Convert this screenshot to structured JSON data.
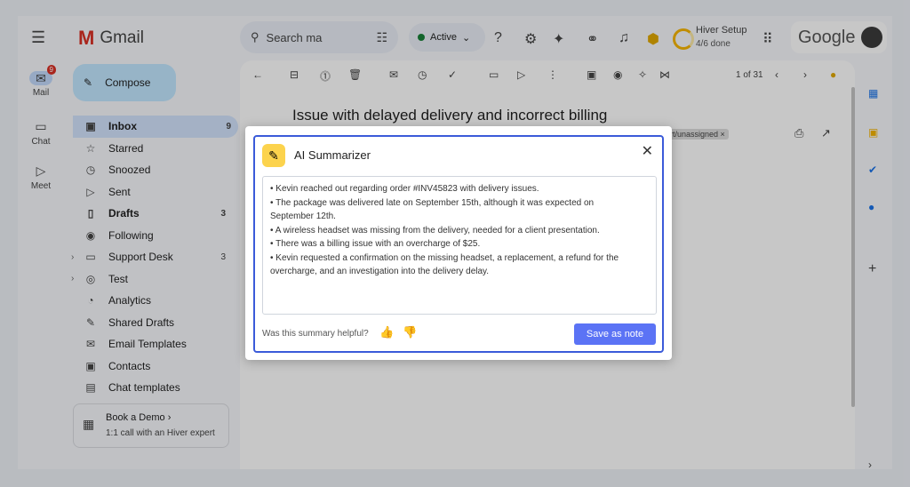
{
  "rail": {
    "mail_label": "Mail",
    "mail_badge": "9",
    "chat_label": "Chat",
    "meet_label": "Meet"
  },
  "brand": {
    "name": "Gmail"
  },
  "compose_label": "Compose",
  "nav": [
    {
      "label": "Inbox",
      "count": "9",
      "icon": "inbox-icon"
    },
    {
      "label": "Starred",
      "count": "",
      "icon": "star-icon"
    },
    {
      "label": "Snoozed",
      "count": "",
      "icon": "clock-icon"
    },
    {
      "label": "Sent",
      "count": "",
      "icon": "send-icon"
    },
    {
      "label": "Drafts",
      "count": "3",
      "icon": "draft-icon"
    },
    {
      "label": "Following",
      "count": "",
      "icon": "eye-icon"
    },
    {
      "label": "Support Desk",
      "count": "3",
      "icon": "inbox-icon"
    },
    {
      "label": "Test",
      "count": "",
      "icon": "chat-icon"
    },
    {
      "label": "Analytics",
      "count": "",
      "icon": "pie-icon"
    },
    {
      "label": "Shared Drafts",
      "count": "",
      "icon": "edit-icon"
    },
    {
      "label": "Email Templates",
      "count": "",
      "icon": "mail-icon"
    },
    {
      "label": "Contacts",
      "count": "",
      "icon": "contact-icon"
    },
    {
      "label": "Chat templates",
      "count": "",
      "icon": "chat-icon"
    }
  ],
  "demo": {
    "title": "Book a Demo  ›",
    "subtitle": "1:1 call with an Hiver expert"
  },
  "search": {
    "placeholder": "Search ma"
  },
  "status": {
    "label": "Active"
  },
  "hiver": {
    "title": "Hiver Setup",
    "progress": "4/6 done"
  },
  "google_label": "Google",
  "email": {
    "subject": "Issue with delayed delivery and incorrect billing",
    "tag": "rt/unassigned ×",
    "pagination": "1 of 31"
  },
  "modal": {
    "title": "AI Summarizer",
    "summary": [
      "• Kevin reached out regarding order #INV45823 with delivery issues.",
      "• The package was delivered late on September 15th, although it was expected on",
      "September 12th.",
      "• A wireless headset was missing from the delivery, needed for a client presentation.",
      "• There was a billing issue with an overcharge of $25.",
      "• Kevin requested a confirmation on the missing headset, a replacement, a refund for the",
      "overcharge, and an investigation into the delivery delay."
    ],
    "helpful_prompt": "Was this summary helpful?",
    "save_label": "Save as note"
  },
  "colors": {
    "accent": "#5b73f5",
    "modal_border": "#3b5bd9",
    "ai_icon_bg": "#fcd34d"
  }
}
